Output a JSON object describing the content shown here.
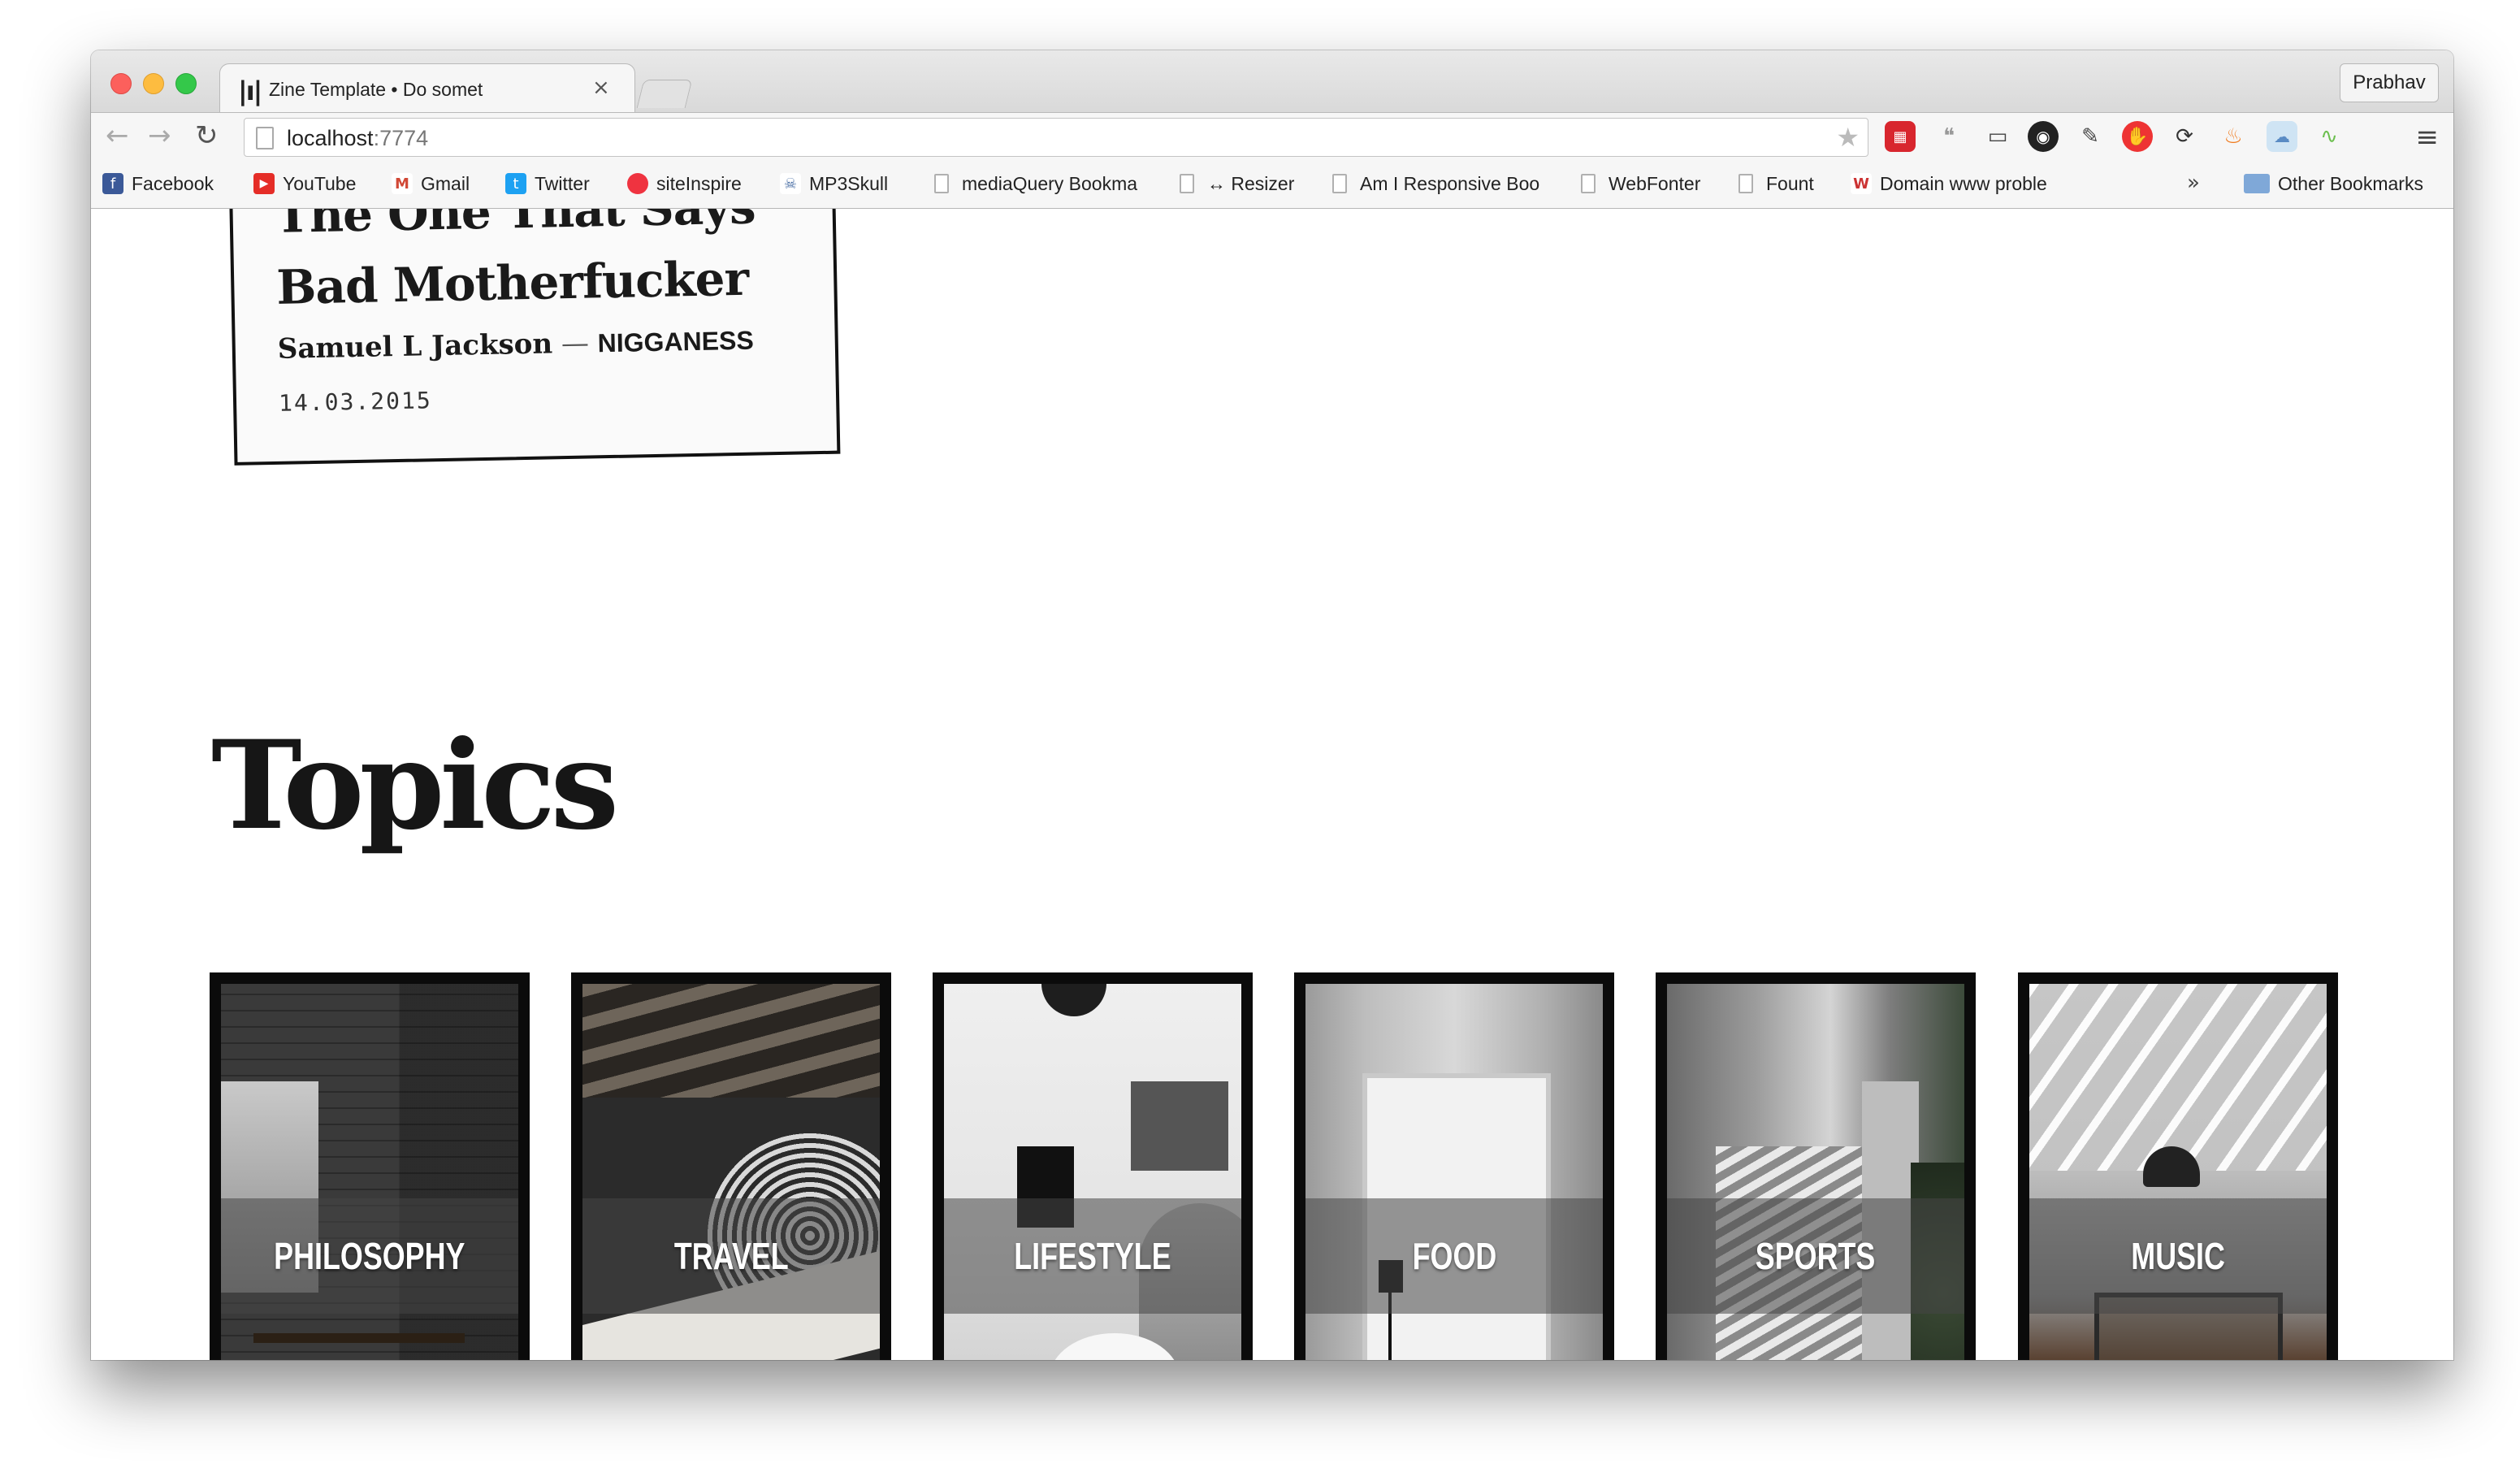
{
  "browser": {
    "tab_title": "Zine Template • Do somet",
    "tab_close": "×",
    "profile_name": "Prabhav",
    "url_host": "localhost",
    "url_port": ":7774",
    "star": "★",
    "menu": "≡",
    "nav": {
      "back": "←",
      "forward": "→",
      "reload": "↻"
    }
  },
  "bookmarks": [
    {
      "label": "Facebook",
      "icon": "facebook-icon",
      "color": "#3b5998",
      "glyph": "f"
    },
    {
      "label": "YouTube",
      "icon": "youtube-icon",
      "color": "#e52d27",
      "glyph": "▶"
    },
    {
      "label": "Gmail",
      "icon": "gmail-icon",
      "color": "#d14836",
      "glyph": "M"
    },
    {
      "label": "Twitter",
      "icon": "twitter-icon",
      "color": "#1da1f2",
      "glyph": "t"
    },
    {
      "label": "siteInspire",
      "icon": "siteinspire-icon",
      "color": "#ef3340",
      "glyph": ""
    },
    {
      "label": "MP3Skull",
      "icon": "mp3skull-icon",
      "color": "#4a6fa5",
      "glyph": "☠"
    },
    {
      "label": "mediaQuery Bookma",
      "icon": "document-icon"
    },
    {
      "label": "↔ Resizer",
      "icon": "document-icon"
    },
    {
      "label": "Am I Responsive Boo",
      "icon": "document-icon"
    },
    {
      "label": "WebFonter",
      "icon": "document-icon"
    },
    {
      "label": "Fount",
      "icon": "document-icon"
    },
    {
      "label": "Domain www proble",
      "icon": "w-icon",
      "color": "#ffffff",
      "glyph": "W"
    }
  ],
  "bookmarks_more": "»",
  "other_bookmarks": "Other Bookmarks",
  "quote": {
    "title_line1": "The One That Says",
    "title_line2": "Bad Motherfucker",
    "author": "Samuel L Jackson",
    "dash": " — ",
    "category": "NIGGANESS",
    "date": "14.03.2015"
  },
  "topics": {
    "heading": "Topics",
    "items": [
      {
        "label": "PHILOSOPHY",
        "name": "philosophy"
      },
      {
        "label": "TRAVEL",
        "name": "travel"
      },
      {
        "label": "LIFESTYLE",
        "name": "lifestyle"
      },
      {
        "label": "FOOD",
        "name": "food"
      },
      {
        "label": "SPORTS",
        "name": "sports"
      },
      {
        "label": "MUSIC",
        "name": "music"
      }
    ]
  }
}
